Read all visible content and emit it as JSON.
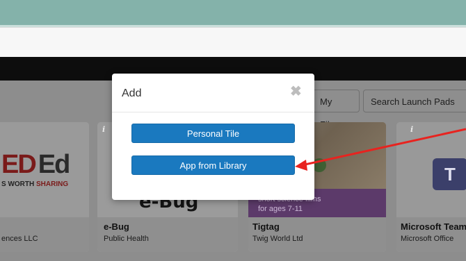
{
  "toolbar": {
    "my_files": "My Files",
    "search_placeholder": "Search Launch Pads"
  },
  "tiles": [
    {
      "logo_main": "ED",
      "logo_ed": "Ed",
      "logo_sub_a": "S WORTH ",
      "logo_sub_b": "SHARING",
      "name": "",
      "publisher": "ences LLC"
    },
    {
      "info": "i",
      "logo": "e-Bug",
      "name": "e-Bug",
      "publisher": "Public Health"
    },
    {
      "info": "i",
      "promo_line1": "short science films",
      "promo_line2": "for ages 7-11",
      "name": "Tigtag",
      "publisher": "Twig World Ltd"
    },
    {
      "info": "i",
      "logo": "T",
      "name": "Microsoft Team",
      "publisher": "Microsoft Office"
    }
  ],
  "modal": {
    "title": "Add",
    "close": "✖",
    "personal_tile": "Personal Tile",
    "app_from_library": "App from Library"
  },
  "annotation": {
    "arrow_color": "#e8231f"
  }
}
